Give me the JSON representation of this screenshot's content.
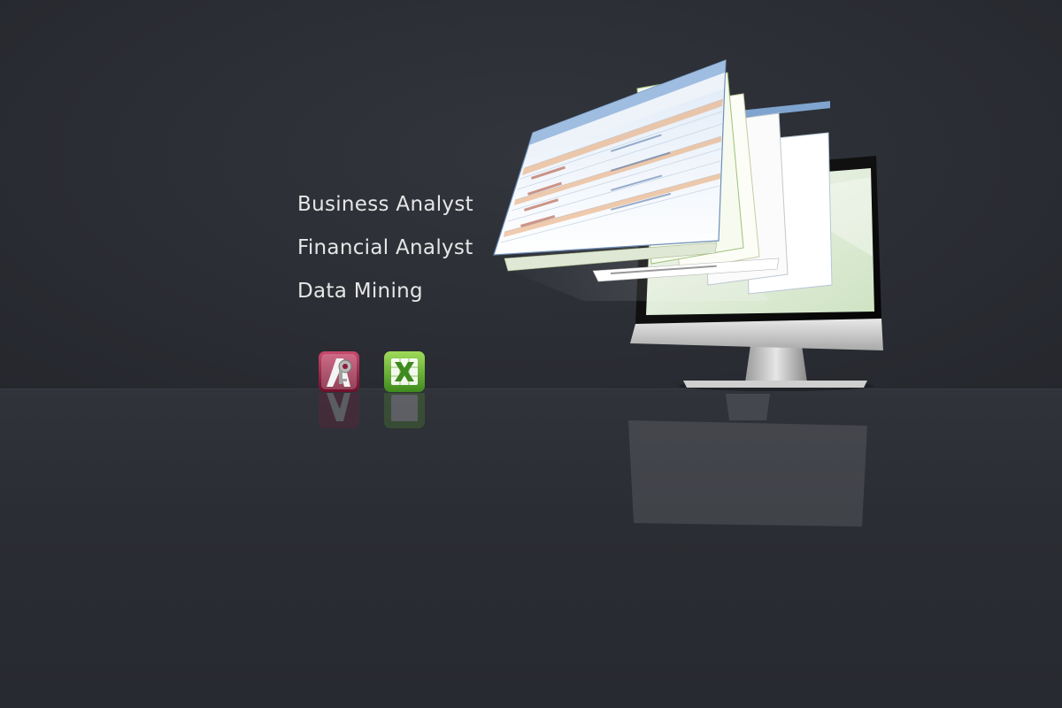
{
  "skills": {
    "items": [
      {
        "label": "Business Analyst"
      },
      {
        "label": "Financial Analyst"
      },
      {
        "label": "Data Mining"
      }
    ]
  },
  "icons": {
    "access": "microsoft-access-icon",
    "excel": "microsoft-excel-icon"
  },
  "colors": {
    "background": "#2a2d33",
    "text": "#e6e6e6",
    "access_brand": "#8c1a3c",
    "excel_brand": "#5fae2e"
  }
}
